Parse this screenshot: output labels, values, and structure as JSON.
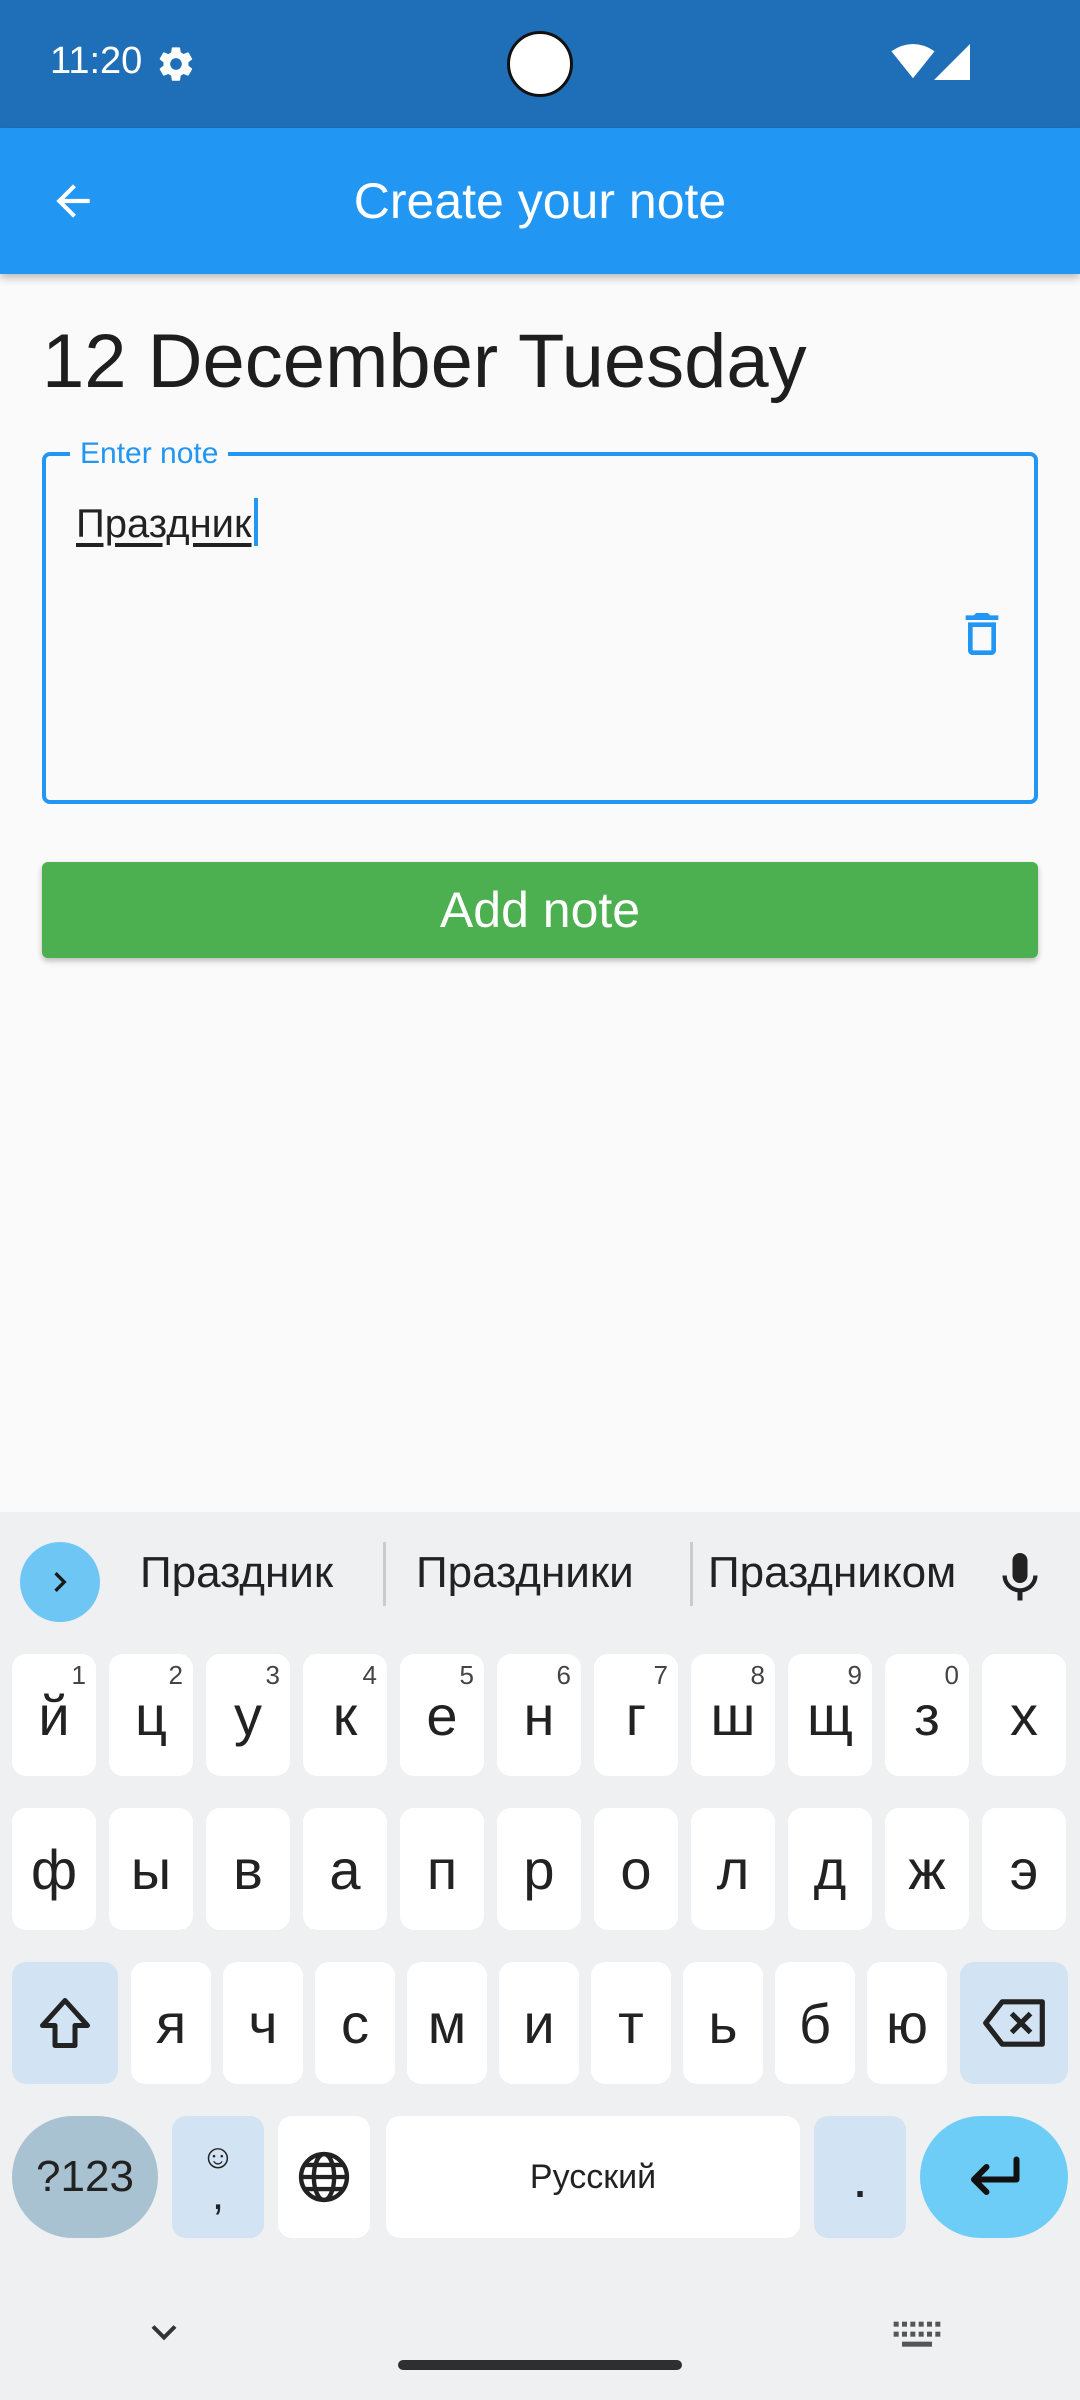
{
  "status_bar": {
    "time": "11:20"
  },
  "app_bar": {
    "title": "Create your note"
  },
  "content": {
    "date_heading": "12 December Tuesday",
    "note_field": {
      "label": "Enter note",
      "value": "Праздник"
    },
    "add_note_label": "Add note"
  },
  "keyboard": {
    "suggestions": [
      "Праздник",
      "Праздники",
      "Праздником"
    ],
    "row1": [
      {
        "char": "й",
        "hint": "1"
      },
      {
        "char": "ц",
        "hint": "2"
      },
      {
        "char": "у",
        "hint": "3"
      },
      {
        "char": "к",
        "hint": "4"
      },
      {
        "char": "е",
        "hint": "5"
      },
      {
        "char": "н",
        "hint": "6"
      },
      {
        "char": "г",
        "hint": "7"
      },
      {
        "char": "ш",
        "hint": "8"
      },
      {
        "char": "щ",
        "hint": "9"
      },
      {
        "char": "з",
        "hint": "0"
      },
      {
        "char": "х",
        "hint": ""
      }
    ],
    "row2": [
      "ф",
      "ы",
      "в",
      "а",
      "п",
      "р",
      "о",
      "л",
      "д",
      "ж",
      "э"
    ],
    "row3": [
      "я",
      "ч",
      "с",
      "м",
      "и",
      "т",
      "ь",
      "б",
      "ю"
    ],
    "num_key": "?123",
    "emoji_key_top": "☺",
    "emoji_key_bottom": ",",
    "space_label": "Русский",
    "period_key": "."
  }
}
